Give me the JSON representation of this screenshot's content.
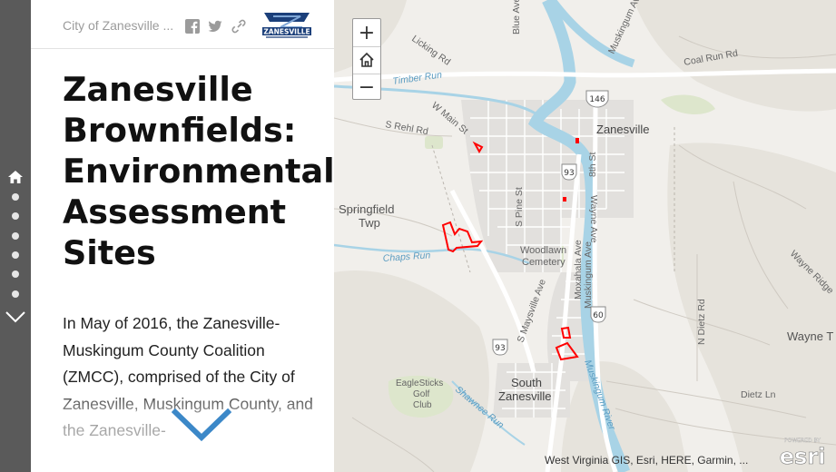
{
  "header": {
    "org_name": "City of Zanesville ...",
    "logo_text": "ZANESVILLE"
  },
  "story": {
    "title": "Zanesville Brownfields: Environmental Assessment Sites",
    "body": "In May of 2016, the Zanesville-Muskingum County Coalition (ZMCC), comprised of the City of Zanesville, Muskingum County, and the Zanesville-"
  },
  "nav": {
    "icons": [
      "home-icon",
      "section-dot",
      "section-dot",
      "section-dot",
      "section-dot",
      "section-dot",
      "section-dot",
      "chevron-down-icon"
    ]
  },
  "map": {
    "zoom_in": "+",
    "zoom_out": "−",
    "attribution": "West Virginia GIS, Esri, HERE, Garmin, ...",
    "esri_powered": "POWERED BY",
    "esri_brand": "esri",
    "labels": {
      "zanesville": "Zanesville",
      "springfield_1": "Springfield",
      "springfield_2": "Twp",
      "woodlawn_1": "Woodlawn",
      "woodlawn_2": "Cemetery",
      "south_1": "South",
      "south_2": "Zanesville",
      "eaglesticks_1": "EagleSticks",
      "eaglesticks_2": "Golf",
      "eaglesticks_3": "Club",
      "wayne": "Wayne T",
      "timber_run": "Timber Run",
      "chaps_run": "Chaps Run",
      "shawnee_run": "Shawnee Run",
      "muskingum_river": "Muskingum River",
      "licking_rd": "Licking Rd",
      "w_main_st": "W Main St",
      "s_rehl_rd": "S Rehl Rd",
      "blue_ave": "Blue Ave",
      "coal_run_rd": "Coal Run Rd",
      "muskingum_ave_n": "Muskingum Ave",
      "eighth_st": "8th St",
      "s_pine_st": "S Pine St",
      "wayne_ave": "Wayne Ave",
      "maysville_ave": "S Maysville Ave",
      "moxahala_ave": "Moxahala Ave",
      "muskingum_ave_s": "Muskingum Ave",
      "n_dietz_rd": "N Dietz Rd",
      "dietz_ln": "Dietz Ln",
      "wayne_ridge": "Wayne Ridge",
      "route_146": "146",
      "route_93_a": "93",
      "route_93_b": "93",
      "route_60": "60"
    },
    "site_color": "#ff0000",
    "water_color": "#a8d3e6",
    "land_color": "#f1efeb"
  }
}
